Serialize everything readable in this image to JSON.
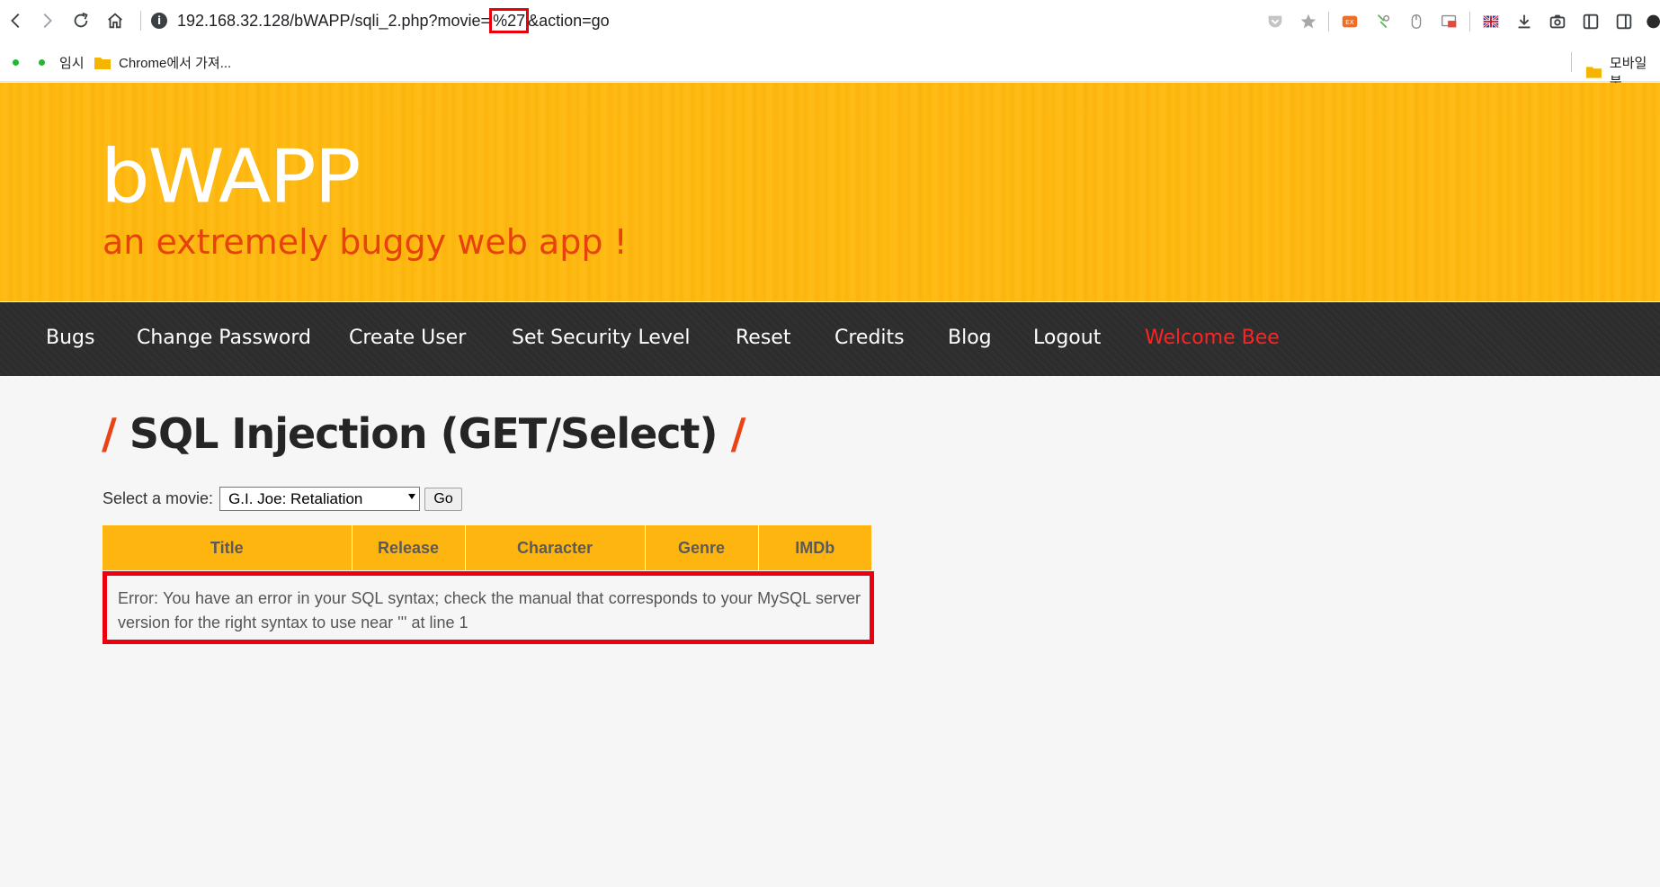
{
  "browser": {
    "url_prefix": "192.168.32.128/bWAPP/sqli_2.php?movie=",
    "url_highlight": "%27",
    "url_suffix": "&action=go",
    "bookmarks": [
      {
        "label": "임시"
      },
      {
        "label": "Chrome에서 가져..."
      }
    ],
    "bookmarks_right": {
      "label": "모바일 북"
    }
  },
  "app": {
    "logo": "bWAPP",
    "tagline": "an extremely buggy web app !",
    "menu": [
      "Bugs",
      "Change Password",
      "Create User",
      "Set Security Level",
      "Reset",
      "Credits",
      "Blog",
      "Logout"
    ],
    "welcome": "Welcome Bee",
    "accent_color": "#ffb50f",
    "welcome_color": "#ff2323"
  },
  "page": {
    "slash_left": "/",
    "title": "SQL Injection (GET/Select)",
    "slash_right": "/",
    "select_label": "Select a movie:",
    "select_value": "G.I. Joe: Retaliation",
    "go_label": "Go",
    "table_headers": [
      "Title",
      "Release",
      "Character",
      "Genre",
      "IMDb"
    ],
    "error_text": "Error: You have an error in your SQL syntax; check the manual that corresponds to your MySQL server version for the right syntax to use near ''' at line 1"
  }
}
